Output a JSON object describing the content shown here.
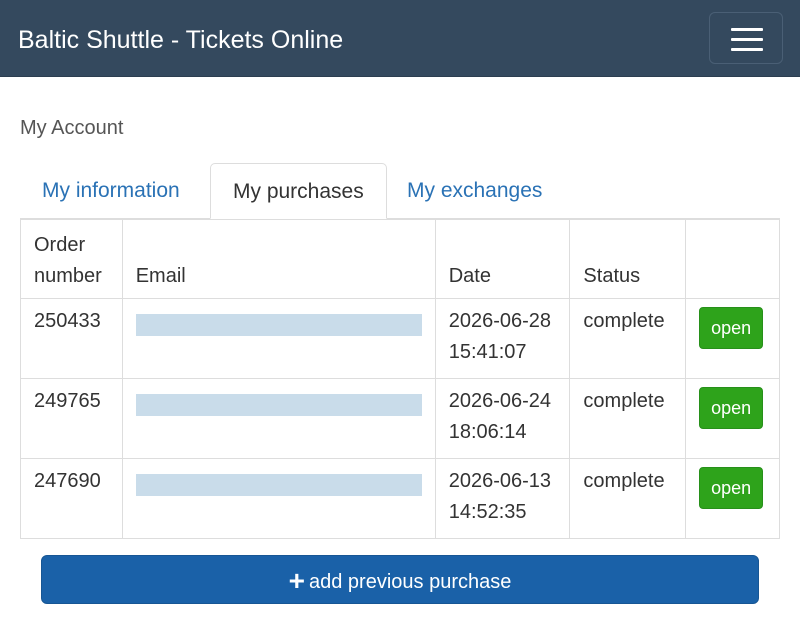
{
  "navbar": {
    "brand": "Baltic Shuttle - Tickets Online",
    "menu_icon": "hamburger-menu-icon"
  },
  "page": {
    "heading": "My Account"
  },
  "tabs": [
    {
      "label": "My information",
      "active": false
    },
    {
      "label": "My purchases",
      "active": true
    },
    {
      "label": "My exchanges",
      "active": false
    }
  ],
  "table": {
    "headers": {
      "order_line1": "Order",
      "order_line2": "number",
      "email": "Email",
      "date": "Date",
      "status": "Status"
    },
    "rows": [
      {
        "order": "250433",
        "date": "2026-06-28",
        "time": "15:41:07",
        "status": "complete",
        "action": "open"
      },
      {
        "order": "249765",
        "date": "2026-06-24",
        "time": "18:06:14",
        "status": "complete",
        "action": "open"
      },
      {
        "order": "247690",
        "date": "2026-06-13",
        "time": "14:52:35",
        "status": "complete",
        "action": "open"
      }
    ]
  },
  "add_button": {
    "icon": "plus-icon",
    "label": "add previous purchase"
  },
  "colors": {
    "navbar": "#34495e",
    "link": "#2a72b5",
    "open_button": "#2ea31b",
    "primary_button": "#1a61a8",
    "redaction": "#c9dcea"
  }
}
